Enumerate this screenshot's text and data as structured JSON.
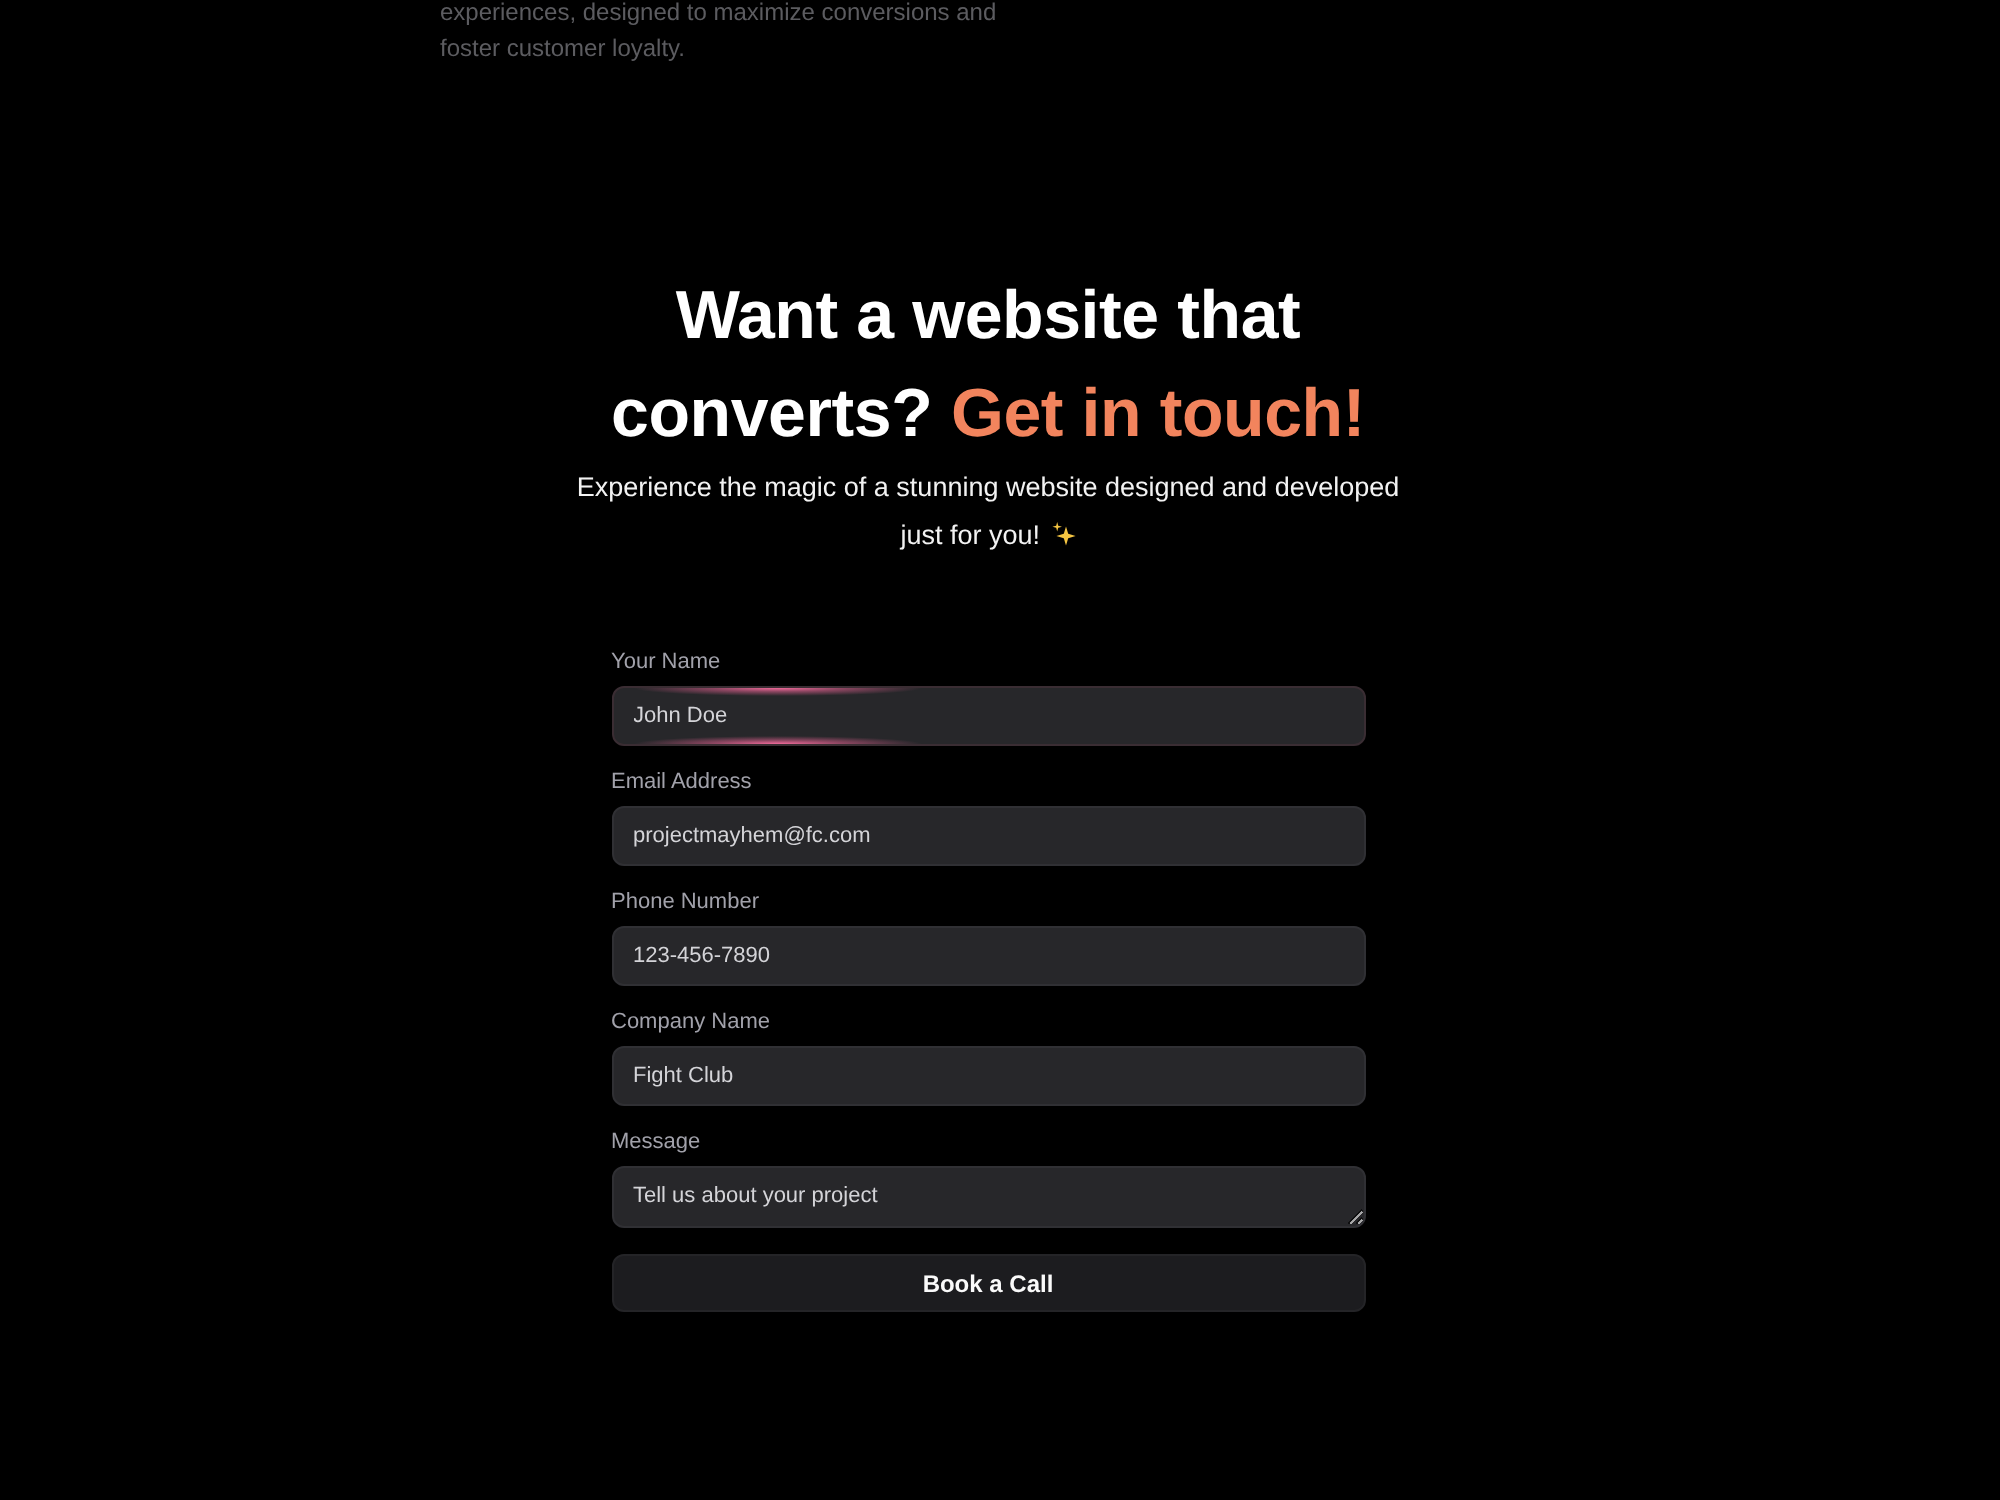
{
  "intro": {
    "text": "experiences, designed to maximize conversions and foster customer loyalty."
  },
  "contact": {
    "title": "Want a website that converts?",
    "highlight": "Get in touch!",
    "subtitle": "Experience the magic of a stunning website designed and developed just for you!",
    "sparkle": true
  },
  "form": {
    "fields": [
      {
        "label": "Your Name",
        "placeholder": "John Doe",
        "kind": "input",
        "focused": true
      },
      {
        "label": "Email Address",
        "placeholder": "projectmayhem@fc.com",
        "kind": "input",
        "focused": false
      },
      {
        "label": "Phone Number",
        "placeholder": "123-456-7890",
        "kind": "input",
        "focused": false
      },
      {
        "label": "Company Name",
        "placeholder": "Fight Club",
        "kind": "input",
        "focused": false
      },
      {
        "label": "Message",
        "placeholder": "Tell us about your project",
        "kind": "textarea",
        "focused": false
      }
    ],
    "submit": "Book a Call"
  }
}
